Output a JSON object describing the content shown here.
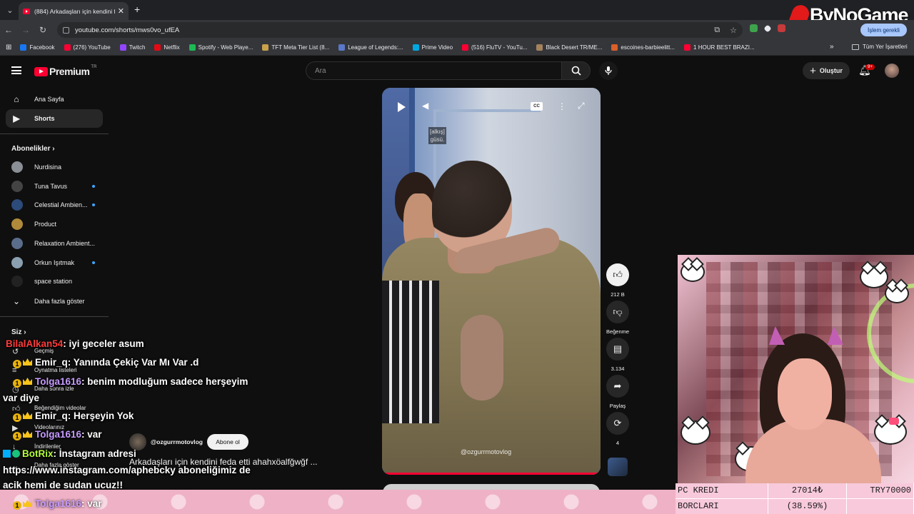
{
  "browser": {
    "tab_title": "(884) Arkadaşları için kendini fe",
    "url": "youtube.com/shorts/mws0vo_ufEA",
    "update_label": "İşlem gerekli",
    "overlay_logo": "ByNoGame"
  },
  "bookmarks": {
    "items": [
      {
        "label": "Facebook",
        "color": "#1877f2"
      },
      {
        "label": "(276) YouTube",
        "color": "#ff0033"
      },
      {
        "label": "Twitch",
        "color": "#9146ff"
      },
      {
        "label": "Netflix",
        "color": "#e50914"
      },
      {
        "label": "Spotify - Web Playe...",
        "color": "#1db954"
      },
      {
        "label": "TFT Meta Tier List (8...",
        "color": "#c9a24a"
      },
      {
        "label": "League of Legends:...",
        "color": "#5a78c8"
      },
      {
        "label": "Prime Video",
        "color": "#00a8e1"
      },
      {
        "label": "(516) FluTV - YouTu...",
        "color": "#ff0033"
      },
      {
        "label": "Black Desert TR/ME...",
        "color": "#a3825d"
      },
      {
        "label": "escoines-barbieelitt...",
        "color": "#d9602a"
      },
      {
        "label": "1 HOUR BEST BRAZI...",
        "color": "#ff0033"
      }
    ],
    "more": "»",
    "all_label": "Tüm Yer İşaretleri"
  },
  "youtube": {
    "logo": "Premium",
    "logo_region": "TR",
    "search_placeholder": "Ara",
    "create_label": "Oluştur",
    "notif_count": "9+"
  },
  "sidebar": {
    "home": "Ana Sayfa",
    "shorts": "Shorts",
    "subs_header": "Abonelikler",
    "subs": [
      {
        "label": "Nurdisina",
        "color": "#8a8f95",
        "dot": false
      },
      {
        "label": "Tuna Tavus",
        "color": "#444",
        "dot": true
      },
      {
        "label": "Celestial Ambien...",
        "color": "#2c4a7a",
        "dot": true
      },
      {
        "label": "Product",
        "color": "#b08a3a",
        "dot": false
      },
      {
        "label": "Relaxation Ambient...",
        "color": "#5a6d8a",
        "dot": false
      },
      {
        "label": "Orkun Işıtmak",
        "color": "#8aa0b0",
        "dot": true
      },
      {
        "label": "space station",
        "color": "#222",
        "dot": false
      }
    ],
    "more": "Daha fazla göster",
    "you_header": "Siz",
    "you_items": [
      "Geçmiş",
      "Oynatma listeleri",
      "Daha sonra izle",
      "Beğendiğim videolar",
      "Videolarınız",
      "İndirilenler",
      "Daha fazla göster"
    ]
  },
  "short": {
    "caption_line1": "[alkış]",
    "caption_line2": "güsü.",
    "watermark": "@ozgurrmotovlog",
    "progress": 1.0,
    "channel": "@ozgurrmotovlog",
    "subscribe": "Abone ol",
    "title": "Arkadaşları için kendini feda etti ahahxöalfğwğf ...",
    "likes": "212 B",
    "dislike_label": "Beğenme",
    "comments": "3.134",
    "share_label": "Paylaş",
    "remix_count": "4"
  },
  "chat": [
    {
      "user": "BilalAlkan54",
      "color": "#ff3b3b",
      "msg": ": iyi geceler asum",
      "badges": ""
    },
    {
      "user": "Emir_q",
      "color": "#ffffff",
      "msg": ": Yanında Çekiç Var Mı Var .d",
      "badges": "sub"
    },
    {
      "user": "Tolga1616",
      "color": "#c79bff",
      "msg": ": benim modluğum sadece herşeyim",
      "badges": "sub"
    },
    {
      "user": "",
      "color": "#ffffff",
      "msg": "var diye",
      "badges": ""
    },
    {
      "user": "Emir_q",
      "color": "#ffffff",
      "msg": ": Herşeyin Yok",
      "badges": "sub"
    },
    {
      "user": "Tolga1616",
      "color": "#c79bff",
      "msg": ": var",
      "badges": "sub"
    },
    {
      "user": "BotRix",
      "color": "#b6ff3b",
      "msg": ": İnstagram adresi",
      "badges": "bot"
    },
    {
      "user": "",
      "color": "#ffffff",
      "msg": "https://www.instagram.com/aphebcky aboneliğimiz de",
      "badges": ""
    },
    {
      "user": "",
      "color": "#ffffff",
      "msg": "acik hemi de sudan ucuz!!",
      "badges": ""
    },
    {
      "user": "Tolga1616",
      "color": "#c79bff",
      "msg": ": var",
      "badges": "sub"
    }
  ],
  "overlay": {
    "debt_label1": "PC KREDI",
    "debt_label2": "BORCLARI",
    "debt_value": "27014₺",
    "debt_pct": "(38.59%)",
    "debt_goal": "TRY70000"
  }
}
